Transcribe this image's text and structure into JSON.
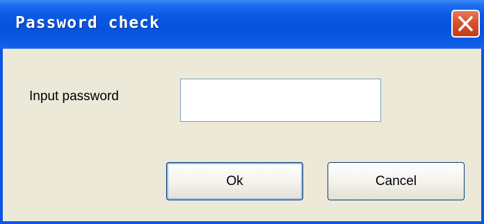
{
  "window": {
    "title": "Password check"
  },
  "form": {
    "password_label": "Input password",
    "password_value": "",
    "ok_label": "Ok",
    "cancel_label": "Cancel"
  },
  "icons": {
    "close": "close-icon"
  },
  "colors": {
    "titlebar": "#0a55e6",
    "close_button": "#d8522f",
    "dialog_background": "#ece9d8",
    "input_border": "#7f9db9",
    "button_border": "#003c74"
  }
}
